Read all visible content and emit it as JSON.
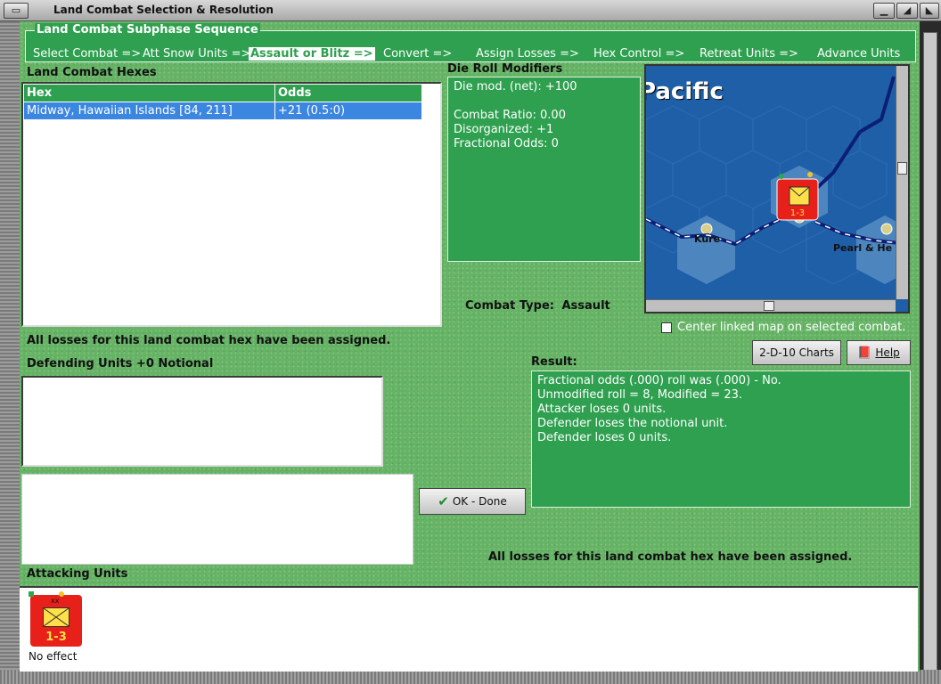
{
  "window": {
    "title": "Land Combat Selection & Resolution"
  },
  "sequence": {
    "title": "Land Combat Subphase Sequence",
    "steps": [
      "Select Combat =>",
      "Att Snow Units =>",
      "Assault or Blitz =>",
      "Convert =>",
      "Assign Losses =>",
      "Hex Control =>",
      "Retreat Units =>",
      "Advance Units"
    ],
    "active_index": 2
  },
  "hexes": {
    "title": "Land Combat Hexes",
    "columns": [
      "Hex",
      "Odds"
    ],
    "rows": [
      {
        "hex": "Midway, Hawaiian Islands [84, 211]",
        "odds": "+21 (0.5:0)"
      }
    ]
  },
  "modifiers": {
    "title": "Die Roll Modifiers",
    "lines": [
      "Die mod. (net): +100",
      "",
      "Combat Ratio: 0.00",
      "Disorganized: +1",
      "Fractional Odds: 0"
    ]
  },
  "combat_type": {
    "label": "Combat Type:",
    "value": "Assault"
  },
  "map": {
    "region_label": "Pacific",
    "places": [
      "Kure",
      "Pearl & He"
    ],
    "center_checkbox": {
      "label": "Center linked map on selected combat.",
      "checked": false
    },
    "unit_strength": "1-3"
  },
  "status_top": "All losses for this land combat hex have been assigned.",
  "defending": {
    "title": "Defending Units +0 Notional"
  },
  "buttons": {
    "charts": "2-D-10 Charts",
    "help": "Help",
    "ok": "OK - Done"
  },
  "result": {
    "title": "Result:",
    "lines": [
      "Fractional odds (.000) roll was (.000)  - No.",
      "Unmodified roll = 8, Modified = 23.",
      "Attacker loses 0 units.",
      "Defender loses the notional unit.",
      "Defender loses 0 units."
    ]
  },
  "status_bottom": "All losses for this land combat hex have been assigned.",
  "attacking": {
    "title": "Attacking Units",
    "units": [
      {
        "strength": "1-3",
        "size": "xx",
        "caption": "No effect"
      }
    ]
  }
}
